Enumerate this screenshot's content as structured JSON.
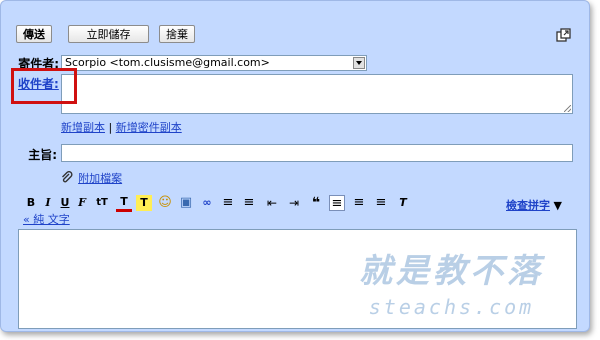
{
  "toolbar": {
    "send": "傳送",
    "save": "立即儲存",
    "discard": "捨棄"
  },
  "from": {
    "label": "寄件者:",
    "value": "Scorpio <tom.clusisme@gmail.com>"
  },
  "to": {
    "label": "收件者:",
    "value": ""
  },
  "cc_links": {
    "cc": "新增副本",
    "sep": "|",
    "bcc": "新增密件副本"
  },
  "subject": {
    "label": "主旨:",
    "value": ""
  },
  "attach": {
    "label": "附加檔案"
  },
  "format": {
    "buttons": [
      {
        "name": "bold-button",
        "glyph": "B"
      },
      {
        "name": "italic-button",
        "glyph": "I"
      },
      {
        "name": "underline-button",
        "glyph": "U"
      },
      {
        "name": "font-button",
        "glyph": "F"
      },
      {
        "name": "font-size-button",
        "glyph": "tT"
      },
      {
        "name": "text-color-button",
        "glyph": "T"
      },
      {
        "name": "highlight-button",
        "glyph": "T"
      },
      {
        "name": "emoticon-button",
        "glyph": "☺"
      },
      {
        "name": "insert-image-button",
        "glyph": "▣"
      },
      {
        "name": "link-button",
        "glyph": "∞"
      },
      {
        "name": "numbered-list-button",
        "glyph": "≡"
      },
      {
        "name": "bulleted-list-button",
        "glyph": "≡"
      },
      {
        "name": "outdent-button",
        "glyph": "⇤"
      },
      {
        "name": "indent-button",
        "glyph": "⇥"
      },
      {
        "name": "quote-button",
        "glyph": "❝"
      },
      {
        "name": "align-left-button",
        "glyph": "≡"
      },
      {
        "name": "align-center-button",
        "glyph": "≡"
      },
      {
        "name": "align-right-button",
        "glyph": "≡"
      },
      {
        "name": "remove-format-button",
        "glyph": "T"
      }
    ],
    "spellcheck": "檢查拼字",
    "plain_text": "« 純 文字"
  },
  "watermark": {
    "cn": "就是教不落",
    "en": "steachs.com"
  },
  "colors": {
    "panel": "#c3d9ff",
    "link": "#1f43c8",
    "highlight": "#d01010"
  }
}
